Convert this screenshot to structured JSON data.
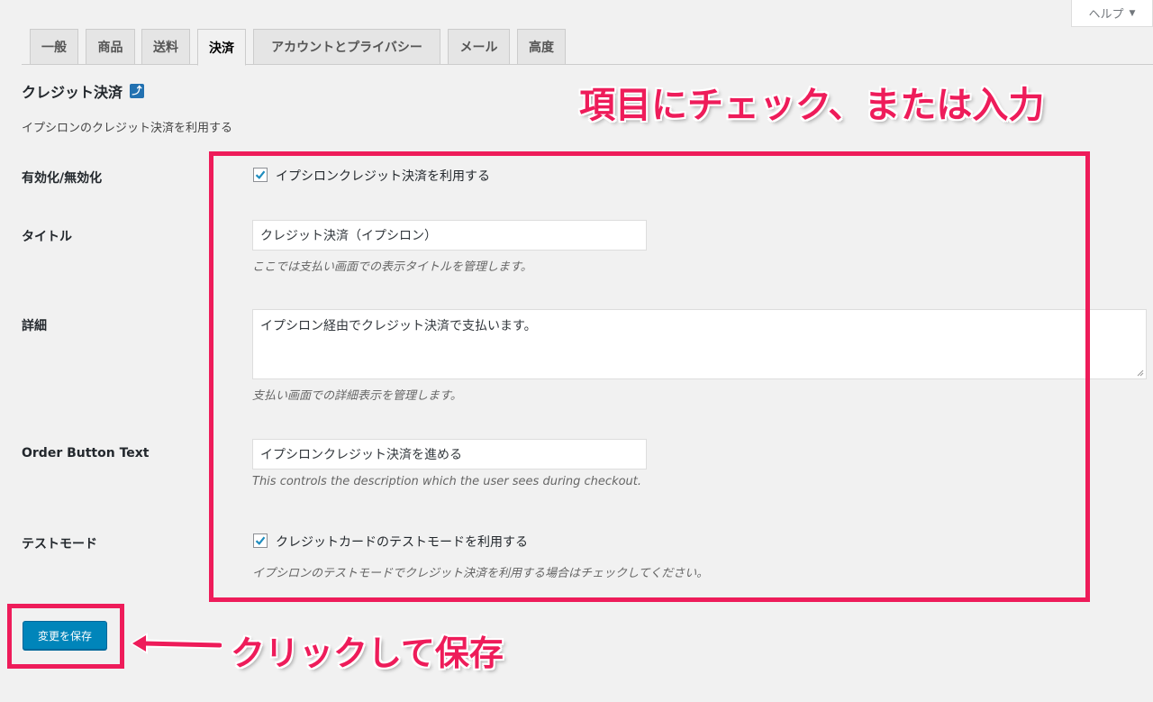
{
  "help": {
    "label": "ヘルプ",
    "caret": "▼"
  },
  "tabs": [
    {
      "label": "一般"
    },
    {
      "label": "商品"
    },
    {
      "label": "送料"
    },
    {
      "label": "決済"
    },
    {
      "label": "アカウントとプライバシー"
    },
    {
      "label": "メール"
    },
    {
      "label": "高度"
    }
  ],
  "section": {
    "title": "クレジット決済",
    "up_icon": "up-return-icon",
    "description": "イプシロンのクレジット決済を利用する"
  },
  "fields": {
    "enable": {
      "label": "有効化/無効化",
      "checkbox_label": "イプシロンクレジット決済を利用する",
      "checked": true
    },
    "title": {
      "label": "タイトル",
      "value": "クレジット決済（イプシロン）",
      "hint": "ここでは支払い画面での表示タイトルを管理します。"
    },
    "details": {
      "label": "詳細",
      "value": "イプシロン経由でクレジット決済で支払います。",
      "hint": "支払い画面での詳細表示を管理します。"
    },
    "order_button": {
      "label": "Order Button Text",
      "value": "イプシロンクレジット決済を進める",
      "hint": "This controls the description which the user sees during checkout."
    },
    "test_mode": {
      "label": "テストモード",
      "checkbox_label": "クレジットカードのテストモードを利用する",
      "checked": true,
      "hint": "イプシロンのテストモードでクレジット決済を利用する場合はチェックしてください。"
    }
  },
  "save_button": {
    "label": "変更を保存"
  },
  "annotations": {
    "top": "項目にチェック、または入力",
    "bottom": "クリックして保存",
    "color": "#ee1c5a"
  }
}
